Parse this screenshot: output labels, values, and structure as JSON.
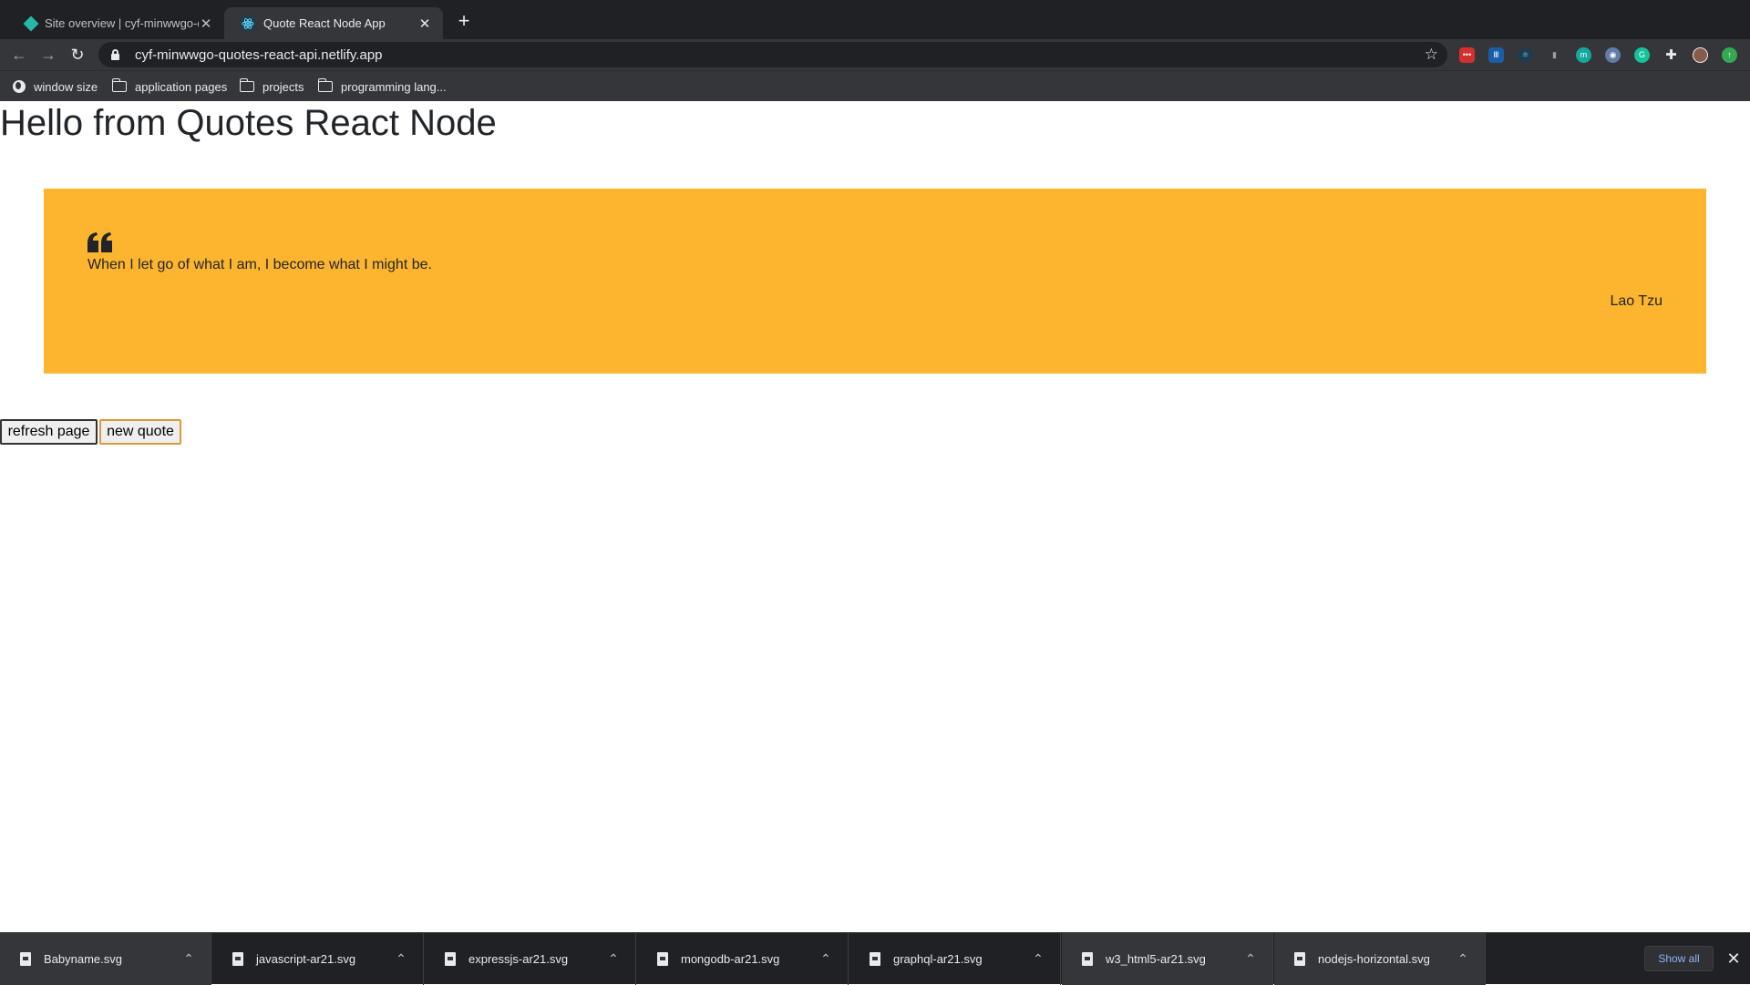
{
  "browser": {
    "tabs": [
      {
        "title": "Site overview | cyf-minwwgo-q"
      },
      {
        "title": "Quote React Node App"
      }
    ],
    "new_tab_symbol": "+",
    "url": "cyf-minwwgo-quotes-react-api.netlify.app",
    "extension_icons": [
      "lastpass-icon",
      "tally-icon",
      "react-devtools-icon",
      "mouse-icon",
      "m-icon",
      "privacy-badger-icon",
      "grammarly-icon",
      "puzzle-extensions-icon",
      "profile-avatar",
      "update-icon"
    ],
    "bookmarks": [
      {
        "label": "window size",
        "icon": "globe-icon"
      },
      {
        "label": "application pages",
        "icon": "folder-icon"
      },
      {
        "label": "projects",
        "icon": "folder-icon"
      },
      {
        "label": "programming lang..."
      }
    ]
  },
  "page": {
    "heading": "Hello from Quotes React Node",
    "quote": {
      "text": "When I let go of what I am, I become what I might be.",
      "author": "Lao Tzu",
      "background": "#fdb52f"
    },
    "buttons": {
      "refresh": "refresh page",
      "new_quote": "new quote"
    }
  },
  "downloads": {
    "items": [
      {
        "name": "Babyname.svg"
      },
      {
        "name": "javascript-ar21.svg"
      },
      {
        "name": "expressjs-ar21.svg"
      },
      {
        "name": "mongodb-ar21.svg"
      },
      {
        "name": "graphql-ar21.svg"
      },
      {
        "name": "w3_html5-ar21.svg"
      },
      {
        "name": "nodejs-horizontal.svg"
      }
    ],
    "show_all": "Show all"
  }
}
